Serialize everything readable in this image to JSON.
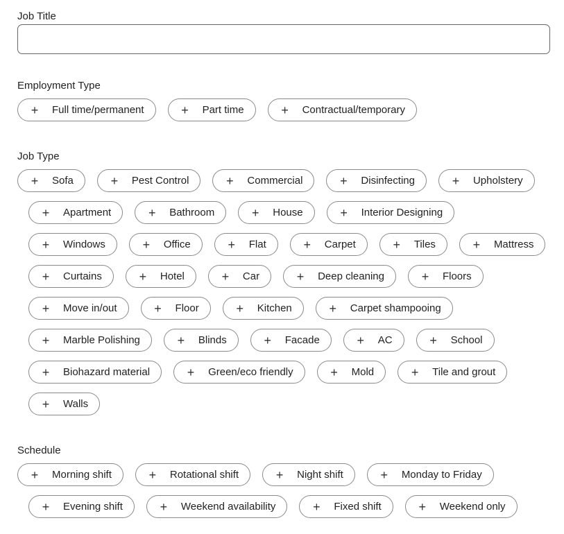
{
  "job_title": {
    "label": "Job Title",
    "value": ""
  },
  "employment_type": {
    "label": "Employment Type",
    "rows": [
      [
        "Full time/permanent",
        "Part time",
        "Contractual/temporary"
      ]
    ]
  },
  "job_type": {
    "label": "Job Type",
    "rows": [
      [
        "Sofa",
        "Pest Control",
        "Commercial",
        "Disinfecting",
        "Upholstery"
      ],
      [
        "Apartment",
        "Bathroom",
        "House",
        "Interior Designing"
      ],
      [
        "Windows",
        "Office",
        "Flat",
        "Carpet",
        "Tiles",
        "Mattress"
      ],
      [
        "Curtains",
        "Hotel",
        "Car",
        "Deep cleaning",
        "Floors"
      ],
      [
        "Move in/out",
        "Floor",
        "Kitchen",
        "Carpet shampooing"
      ],
      [
        "Marble Polishing",
        "Blinds",
        "Facade",
        "AC",
        "School"
      ],
      [
        "Biohazard material",
        "Green/eco friendly",
        "Mold",
        "Tile and grout"
      ],
      [
        "Walls"
      ]
    ]
  },
  "schedule": {
    "label": "Schedule",
    "rows": [
      [
        "Morning shift",
        "Rotational shift",
        "Night shift",
        "Monday to Friday"
      ],
      [
        "Evening shift",
        "Weekend availability",
        "Fixed shift",
        "Weekend only"
      ]
    ]
  },
  "icons": {
    "chip": "plus-icon"
  },
  "plus_glyph": "+"
}
